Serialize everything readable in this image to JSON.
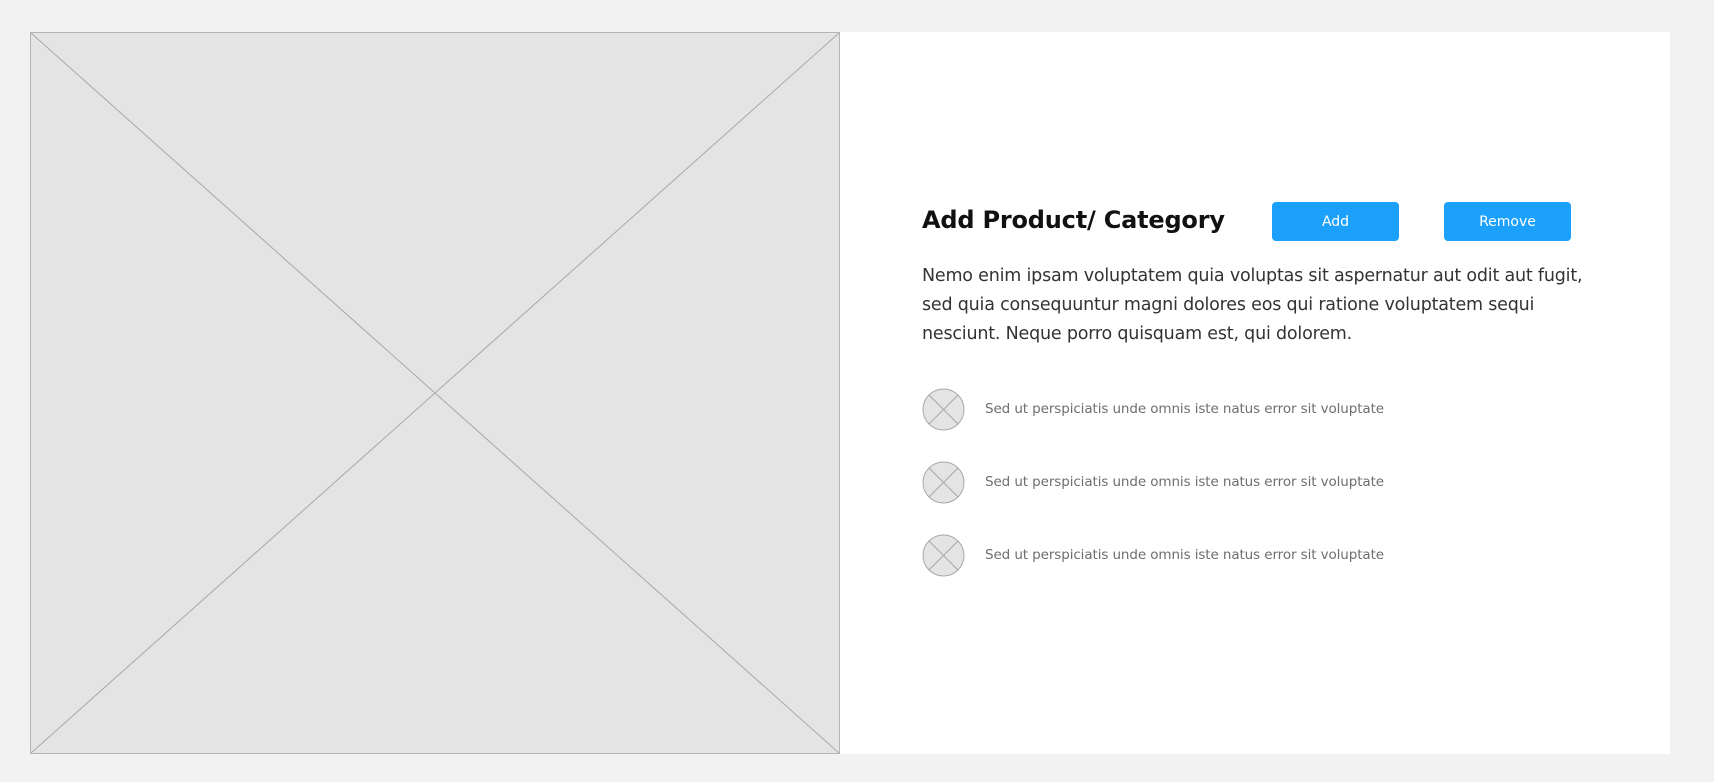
{
  "main": {
    "image_placeholder_icon": "image-placeholder-icon",
    "title": "Add Product/ Category",
    "buttons": {
      "add_label": "Add",
      "remove_label": "Remove"
    },
    "description": "Nemo enim ipsam voluptatem quia voluptas sit aspernatur aut odit aut fugit, sed quia consequuntur magni dolores eos qui ratione voluptatem sequi nesciunt. Neque porro quisquam est, qui dolorem.",
    "features": [
      {
        "icon": "placeholder-circle-icon",
        "text": "Sed ut perspiciatis unde omnis iste natus error sit voluptate"
      },
      {
        "icon": "placeholder-circle-icon",
        "text": "Sed ut perspiciatis unde omnis iste natus error sit voluptate"
      },
      {
        "icon": "placeholder-circle-icon",
        "text": "Sed ut perspiciatis unde omnis iste natus error sit voluptate"
      }
    ]
  },
  "colors": {
    "page_background": "#f2f2f2",
    "card_background": "#ffffff",
    "placeholder_fill": "#e4e4e4",
    "placeholder_stroke": "#b5b5b5",
    "button_background": "#1ba0fb",
    "button_text": "#ffffff",
    "title_text": "#111111",
    "body_text": "#333333",
    "feature_text": "#6e6e6e"
  }
}
